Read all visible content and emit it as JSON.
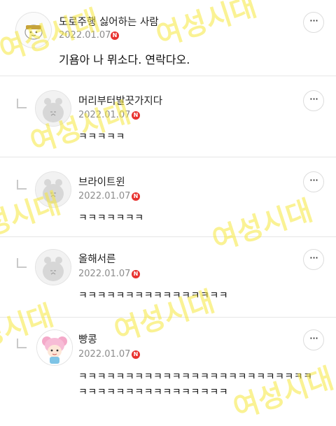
{
  "watermark": "여성시대",
  "comments": [
    {
      "nickname": "도로주행 싫어하는 사람",
      "date": "2022.01.07",
      "badge": "N",
      "text": "기욤아 나 뮈소다. 연락다오.",
      "more": "···"
    },
    {
      "nickname": "머리부터발끗가지다",
      "date": "2022.01.07",
      "badge": "N",
      "text": "ㅋㅋㅋㅋㅋ",
      "more": "···"
    },
    {
      "nickname": "브라이트윈",
      "date": "2022.01.07",
      "badge": "N",
      "text": "ㅋㅋㅋㅋㅋㅋㅋ",
      "more": "···"
    },
    {
      "nickname": "올해서른",
      "date": "2022.01.07",
      "badge": "N",
      "text": "ㅋㅋㅋㅋㅋㅋㅋㅋㅋㅋㅋㅋㅋㅋㅋㅋ",
      "more": "···"
    },
    {
      "nickname": "빵콩",
      "date": "2022.01.07",
      "badge": "N",
      "text_line1": "ㅋㅋㅋㅋㅋㅋㅋㅋㅋㅋㅋㅋㅋㅋㅋㅋㅋㅋㅋㅋㅋㅋㅋㅋㅋ",
      "text_line2": "ㅋㅋㅋㅋㅋㅋㅋㅋㅋㅋㅋㅋㅋㅋㅋㅋ",
      "more": "···"
    }
  ]
}
